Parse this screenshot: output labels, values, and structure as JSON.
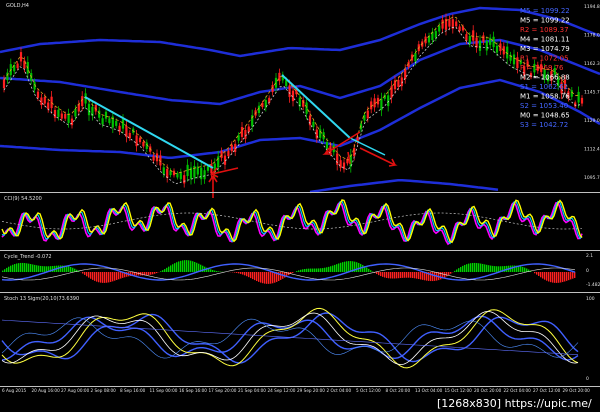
{
  "window": {
    "symbol_title": "GOLD,H4",
    "indicator1_title": "CCI(9) 54.5200",
    "indicator2_title": "Cycle_Trend  -0.072",
    "indicator3_title": "Stoch 13 Sigm(20,10)73.6390",
    "watermark": "[1268x830] https://upic.me/"
  },
  "price_axis": [
    "1194.80",
    "1178.00",
    "1162.35",
    "1145.70",
    "1129.05",
    "1112.40",
    "1095.75"
  ],
  "indicator2_axis": [
    "2.1",
    "0",
    "-1.482"
  ],
  "indicator3_axis": [
    "100",
    "0"
  ],
  "time_axis": [
    "6 Aug 2015",
    "20 Aug 16:00",
    "27 Aug 00:00",
    "2 Sep 08:00",
    "8 Sep 16:00",
    "11 Sep 00:00",
    "16 Sep 16:00",
    "17 Sep 20:00",
    "21 Sep 04:00",
    "24 Sep 12:00",
    "29 Sep 20:00",
    "2 Oct 04:00",
    "5 Oct 12:00",
    "8 Oct 20:00",
    "13 Oct 04:00",
    "15 Oct 12:00",
    "20 Oct 20:00",
    "22 Oct 04:00",
    "27 Oct 12:00",
    "29 Oct 20:00"
  ],
  "pivot_levels": [
    {
      "label": "M5 = 1099.22",
      "color": "#4466ff"
    },
    {
      "label": "M5 = 1099.22",
      "color": "#ffffff"
    },
    {
      "label": "R2 = 1089.37",
      "color": "#ff3030"
    },
    {
      "label": "M4 = 1081.11",
      "color": "#ffffff"
    },
    {
      "label": "M3 = 1074.79",
      "color": "#ffffff"
    },
    {
      "label": "R1 = 1072.05",
      "color": "#ff3030"
    },
    {
      "label": "P = 1068.76",
      "color": "#ff3030"
    },
    {
      "label": "M2 = 1066.88",
      "color": "#ffffff"
    },
    {
      "label": "S1 = 1062.61",
      "color": "#4466ff"
    },
    {
      "label": "M1 = 1058.76",
      "color": "#ffffff"
    },
    {
      "label": "S2 = 1053.40",
      "color": "#4466ff"
    },
    {
      "label": "M0 = 1048.65",
      "color": "#ffffff"
    },
    {
      "label": "S3 = 1042.72",
      "color": "#4466ff"
    }
  ],
  "colors": {
    "background": "#000000",
    "bull_candle": "#00c000",
    "bear_candle": "#ff2020",
    "envelope": "#1e2ed8",
    "trendline": "#30d8f0",
    "arrow": "#e01010",
    "cci_line": "#ffff00",
    "separator": "#c0c0c0"
  }
}
